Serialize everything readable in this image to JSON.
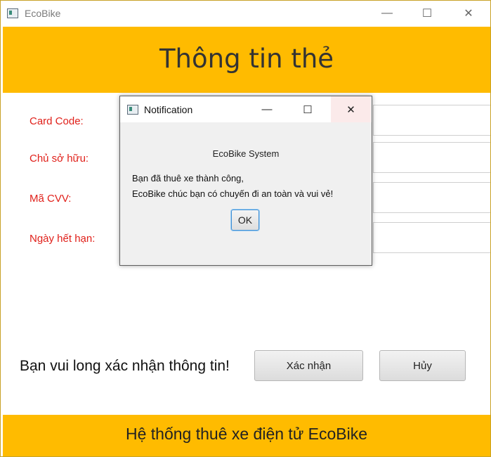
{
  "window": {
    "title": "EcoBike",
    "minimize": "—",
    "maximize": "☐",
    "close": "✕"
  },
  "header": {
    "title": "Thông tin thẻ"
  },
  "form": {
    "labels": [
      "Card Code:",
      "Chủ sở hữu:",
      "Mã CVV:",
      "Ngày hết hạn:"
    ],
    "confirm_text": "Bạn vui long xác nhận thông tin!",
    "confirm_button": "Xác nhận",
    "cancel_button": "Hủy"
  },
  "footer": {
    "title": "Hệ thống thuê xe điện tử EcoBike"
  },
  "dialog": {
    "title": "Notification",
    "minimize": "—",
    "maximize": "☐",
    "close": "✕",
    "header": "EcoBike System",
    "message_line1": "Bạn đã thuê xe thành công,",
    "message_line2": "EcoBike chúc bạn có chuyến đi an toàn và vui vẻ!",
    "ok_button": "OK"
  },
  "colors": {
    "accent": "#ffbb00",
    "label_red": "#e0201a"
  }
}
